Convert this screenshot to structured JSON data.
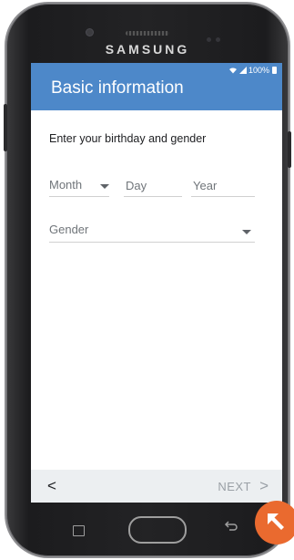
{
  "device": {
    "brand": "SAMSUNG"
  },
  "status_bar": {
    "battery": "100%"
  },
  "header": {
    "title": "Basic information"
  },
  "form": {
    "instruction": "Enter your birthday and gender",
    "month_placeholder": "Month",
    "day_placeholder": "Day",
    "year_placeholder": "Year",
    "gender_placeholder": "Gender"
  },
  "footer": {
    "back": "<",
    "next": "NEXT",
    "next_chevron": ">"
  },
  "colors": {
    "header": "#4d88c9",
    "corner_badge": "#ea6a2f",
    "footer_bg": "#eceff1"
  },
  "icons": [
    "wifi-icon",
    "signal-icon",
    "battery-icon",
    "chevron-down-icon",
    "recent-apps-icon",
    "home-button",
    "back-nav-icon",
    "arrow-up-left-icon"
  ]
}
